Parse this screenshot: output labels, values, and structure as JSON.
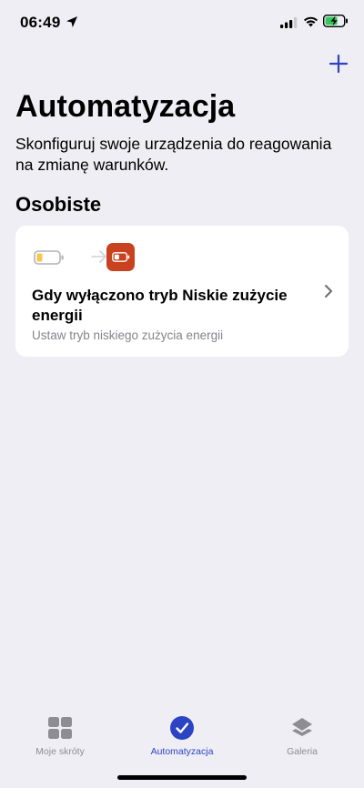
{
  "status_bar": {
    "time": "06:49"
  },
  "header": {
    "add_icon": "plus-icon",
    "title": "Automatyzacja",
    "subtitle": "Skonfiguruj swoje urządzenia do reagowania na zmianę warunków."
  },
  "section": {
    "title": "Osobiste",
    "automations": [
      {
        "title": "Gdy wyłączono tryb Niskie zużycie energii",
        "subtitle": "Ustaw tryb niskiego zużycia energii",
        "trigger_icon": "low-battery-icon",
        "action_icon": "low-power-mode-icon",
        "action_color": "#c8421f"
      }
    ]
  },
  "tab_bar": {
    "tabs": [
      {
        "label": "Moje skróty",
        "icon": "grid-icon",
        "active": false
      },
      {
        "label": "Automatyzacja",
        "icon": "clock-check-icon",
        "active": true
      },
      {
        "label": "Galeria",
        "icon": "layers-icon",
        "active": false
      }
    ]
  },
  "colors": {
    "accent": "#2c44c4",
    "background": "#efeef4",
    "card": "#ffffff"
  }
}
